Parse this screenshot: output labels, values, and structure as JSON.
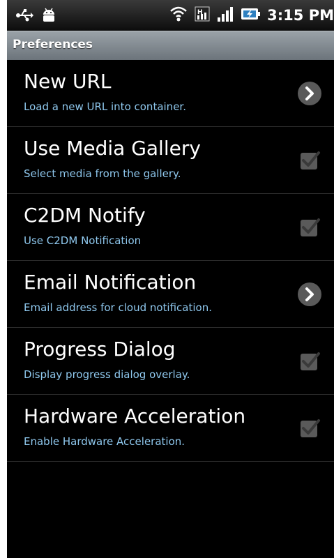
{
  "status_bar": {
    "time": "3:15 PM",
    "icons": [
      "usb-icon",
      "android-debug-icon",
      "wifi-icon",
      "data-h-icon",
      "signal-icon",
      "battery-charging-icon"
    ]
  },
  "title_bar": {
    "title": "Preferences"
  },
  "preferences": [
    {
      "title": "New URL",
      "summary": "Load a new URL into container.",
      "widget": "chevron-right-icon",
      "checked": null
    },
    {
      "title": "Use Media Gallery",
      "summary": "Select media from the gallery.",
      "widget": "checkbox-icon",
      "checked": true
    },
    {
      "title": "C2DM Notify",
      "summary": "Use C2DM Notification",
      "widget": "checkbox-icon",
      "checked": true
    },
    {
      "title": "Email Notification",
      "summary": "Email address for cloud notification.",
      "widget": "chevron-right-icon",
      "checked": null
    },
    {
      "title": "Progress Dialog",
      "summary": "Display progress dialog overlay.",
      "widget": "checkbox-icon",
      "checked": true
    },
    {
      "title": "Hardware Acceleration",
      "summary": "Enable Hardware Acceleration.",
      "widget": "checkbox-icon",
      "checked": true
    }
  ],
  "colors": {
    "summary_text": "#8fc8ee",
    "title_bar": "#8a9298",
    "background": "#000000"
  }
}
